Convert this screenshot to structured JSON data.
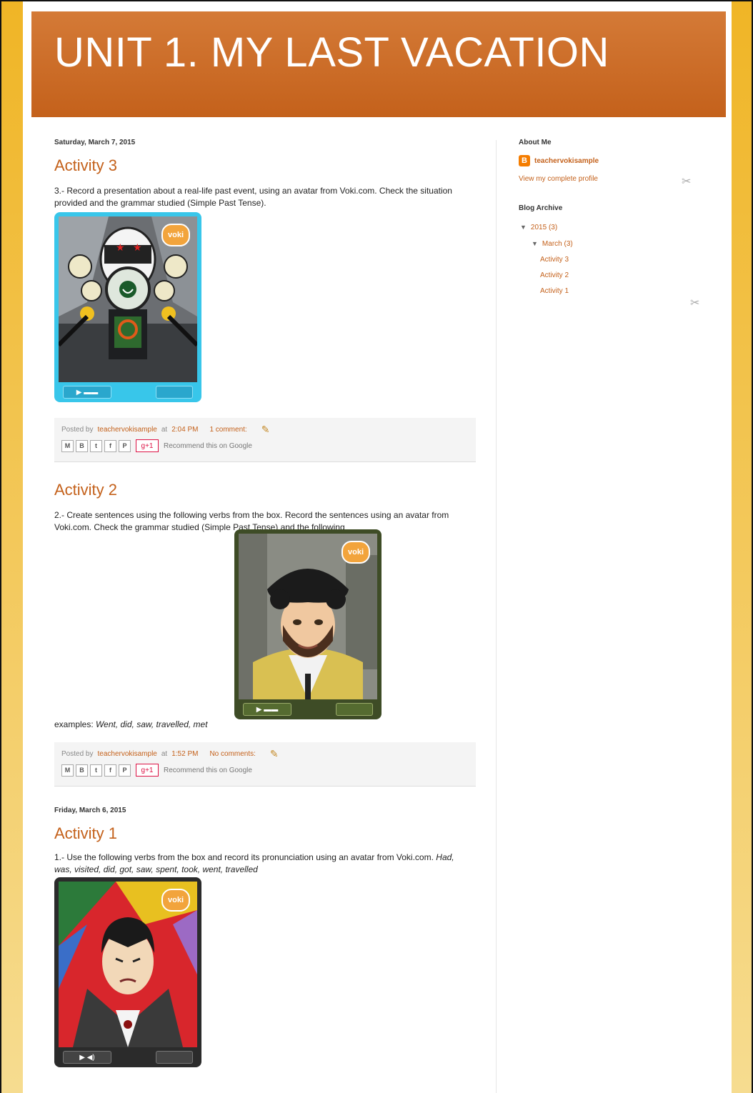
{
  "header": {
    "title": "UNIT 1. MY LAST VACATION"
  },
  "posts_group_1": {
    "date": "Saturday, March 7, 2015",
    "posts": [
      {
        "title": "Activity 3",
        "body": "3.- Record a presentation about a real-life past event, using an avatar from Voki.com. Check the situation provided and the grammar studied (Simple Past Tense).",
        "footer": {
          "posted_by_prefix": "Posted by",
          "author": "teachervokisample",
          "at": "at",
          "time": "2:04 PM",
          "comments": "1 comment:",
          "recommend": "Recommend this on Google"
        }
      },
      {
        "title": "Activity 2",
        "body": "2.- Create sentences using the following verbs from the box. Record the sentences using an avatar from Voki.com. Check the grammar studied (Simple Past Tense) and the following",
        "examples_prefix": "examples:",
        "examples": "Went, did, saw, travelled, met",
        "footer": {
          "posted_by_prefix": "Posted by",
          "author": "teachervokisample",
          "at": "at",
          "time": "1:52 PM",
          "comments": "No comments:",
          "recommend": "Recommend this on Google"
        }
      }
    ]
  },
  "posts_group_2": {
    "date": "Friday, March 6, 2015",
    "posts": [
      {
        "title": "Activity 1",
        "body_prefix": "1.- Use the following verbs from the box and record its pronunciation using an avatar from Voki.com.",
        "body_verbs": "Had, was, visited, did, got, saw, spent, took, went, travelled"
      }
    ]
  },
  "voki_badge": "voki",
  "share_buttons": [
    "M",
    "B",
    "t",
    "f",
    "P"
  ],
  "gplus_label": "g+1",
  "sidebar": {
    "about_title": "About Me",
    "profile_name": "teachervokisample",
    "profile_link": "View my complete profile",
    "archive_title": "Blog Archive",
    "archive": {
      "year": "2015 (3)",
      "month": "March (3)",
      "items": [
        "Activity 3",
        "Activity 2",
        "Activity 1"
      ]
    }
  },
  "colors": {
    "accent": "#c4611b",
    "header_bg": "#cc6a25",
    "frame": "#f0b826"
  }
}
